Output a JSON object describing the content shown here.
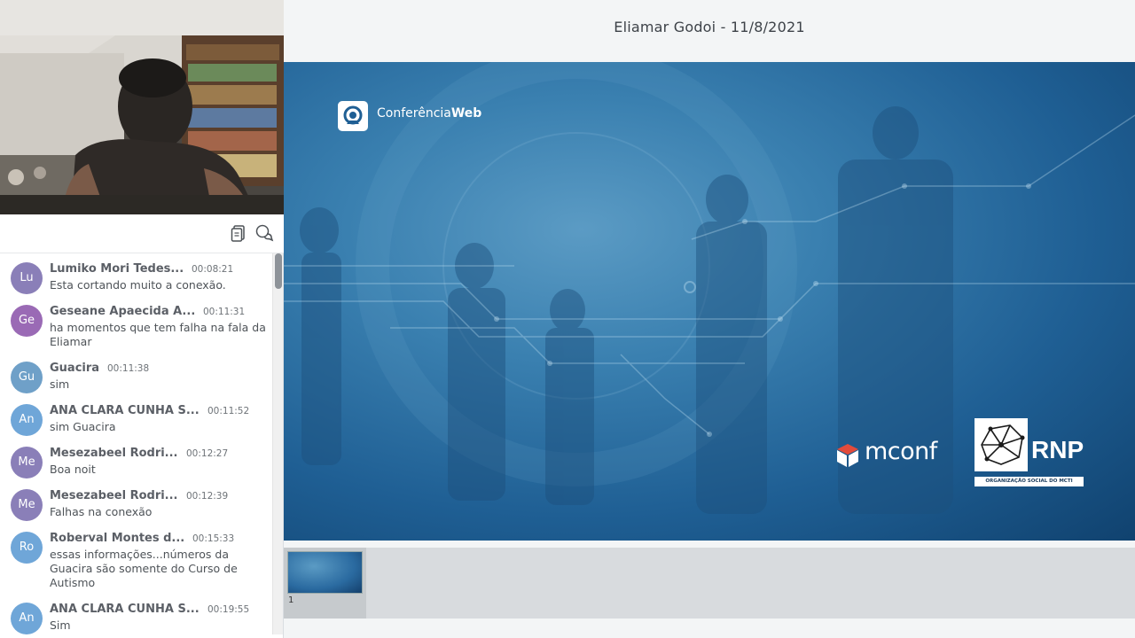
{
  "title": "Eliamar Godoi - 11/8/2021",
  "slide": {
    "brand_prefix": "Conferência",
    "brand_suffix": "Web",
    "mconf": "mconf",
    "rnp": "RNP",
    "rnp_subtitle": "ORGANIZAÇÃO SOCIAL DO MCTI"
  },
  "thumbnails": [
    {
      "number": "1"
    }
  ],
  "chat": {
    "icons": [
      "copy-icon",
      "chat-bubbles-icon"
    ],
    "messages": [
      {
        "initials": "Lu",
        "color": "#8a7fb8",
        "name": "Lumiko Mori Tedes...",
        "time": "00:08:21",
        "lines": [
          "Esta cortando muito a conexão."
        ]
      },
      {
        "initials": "Ge",
        "color": "#9a6ab5",
        "name": "Geseane Apaecida A...",
        "time": "00:11:31",
        "lines": [
          "ha momentos que tem falha na fala da",
          "Eliamar"
        ]
      },
      {
        "initials": "Gu",
        "color": "#6fa0c8",
        "name": "Guacira",
        "time": "00:11:38",
        "lines": [
          "sim"
        ]
      },
      {
        "initials": "An",
        "color": "#6fa6d8",
        "name": "ANA CLARA CUNHA S...",
        "time": "00:11:52",
        "lines": [
          "sim Guacira"
        ]
      },
      {
        "initials": "Me",
        "color": "#8a7fb8",
        "name": "Mesezabeel Rodri...",
        "time": "00:12:27",
        "lines": [
          "Boa noit"
        ]
      },
      {
        "initials": "Me",
        "color": "#8a7fb8",
        "name": "Mesezabeel Rodri...",
        "time": "00:12:39",
        "lines": [
          "Falhas na conexão"
        ]
      },
      {
        "initials": "Ro",
        "color": "#6fa6d8",
        "name": "Roberval Montes d...",
        "time": "00:15:33",
        "lines": [
          "essas informações...números  da",
          "Guacira são somente do Curso de",
          "Autismo"
        ]
      },
      {
        "initials": "An",
        "color": "#6fa6d8",
        "name": "ANA CLARA CUNHA S...",
        "time": "00:19:55",
        "lines": [
          "Sim"
        ]
      }
    ]
  }
}
